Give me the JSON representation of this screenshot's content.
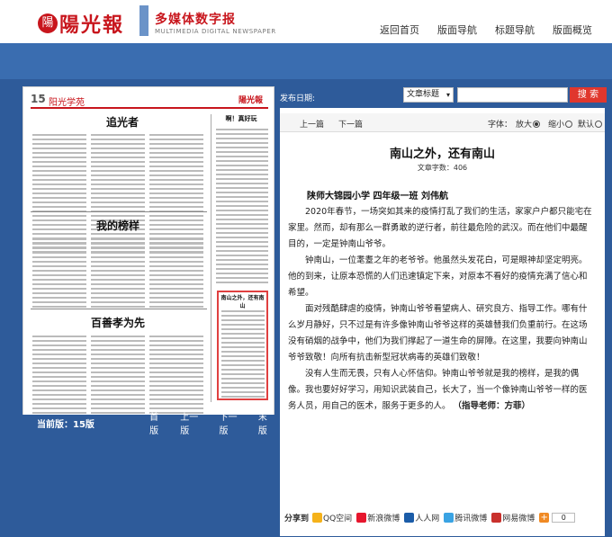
{
  "header": {
    "logo_badge": "陽",
    "logo_text": "陽光報",
    "site_name_cn": "多媒体数字报",
    "site_name_en": "MULTIMEDIA DIGITAL NEWSPAPER",
    "nav": [
      "返回首页",
      "版面导航",
      "标题导航",
      "版面概览"
    ]
  },
  "newspaper": {
    "page_label": "15",
    "section": "阳光学苑",
    "masthead": "陽光報",
    "articles": [
      {
        "title": "追光者"
      },
      {
        "title": "我的榜样"
      },
      {
        "title": "百善孝为先"
      },
      {
        "title": "啊！真好玩"
      },
      {
        "title": "南山之外，还有南山"
      }
    ],
    "current_page": "当前版：15版",
    "nav": [
      "首版",
      "上一版",
      "下一版",
      "末版"
    ]
  },
  "search": {
    "label": "发布日期:",
    "type": "文章标题",
    "button": "搜 索"
  },
  "toolbar": {
    "prev": "上一篇",
    "next": "下一篇",
    "font_label": "字体：",
    "options": [
      "放大",
      "缩小",
      "默认"
    ]
  },
  "article": {
    "title": "南山之外，还有南山",
    "views": "文章字数：406",
    "author": "陕师大锦园小学 四年级一班 刘伟航",
    "paragraphs": [
      "2020年春节，一场突如其来的疫情打乱了我们的生活，家家户户都只能宅在家里。然而，却有那么一群勇敢的逆行者，前往最危险的武汉。而在他们中最醒目的，一定是钟南山爷爷。",
      "钟南山，一位耄耋之年的老爷爷。他虽然头发花白，可是眼神却坚定明亮。他的到来，让原本恐慌的人们迅速镇定下来，对原本不看好的疫情充满了信心和希望。",
      "面对残酷肆虐的疫情，钟南山爷爷看望病人、研究良方、指导工作。哪有什么岁月静好，只不过是有许多像钟南山爷爷这样的英雄替我们负重前行。在这场没有硝烟的战争中，他们为我们撑起了一道生命的屏障。在这里，我要向钟南山爷爷致敬！向所有抗击新型冠状病毒的英雄们致敬！",
      "没有人生而无畏，只有人心怀信仰。钟南山爷爷就是我的榜样，是我的偶像。我也要好好学习，用知识武装自己，长大了，当一个像钟南山爷爷一样的医务人员，用自己的医术，服务于更多的人。"
    ],
    "teacher": "（指导老师：方菲）"
  },
  "share": {
    "label": "分享到",
    "items": [
      {
        "name": "QQ空间",
        "color": "#f5b21a"
      },
      {
        "name": "新浪微博",
        "color": "#e6162d"
      },
      {
        "name": "人人网",
        "color": "#1b5ca8"
      },
      {
        "name": "腾讯微博",
        "color": "#3aa3e3"
      },
      {
        "name": "网易微博",
        "color": "#c9302c"
      }
    ],
    "count": "0"
  }
}
